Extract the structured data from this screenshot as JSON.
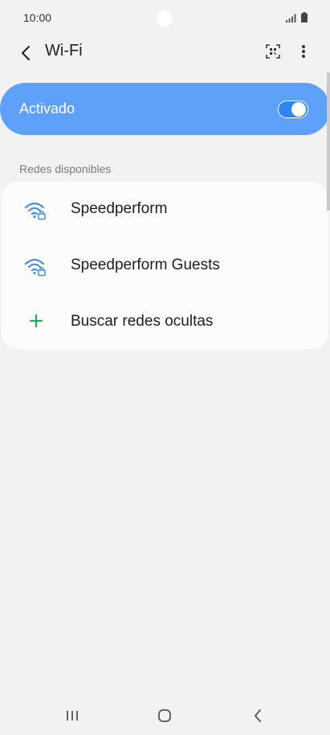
{
  "status_bar": {
    "time": "10:00",
    "signal_icon": "signal-icon",
    "battery_icon": "battery-icon"
  },
  "header": {
    "title": "Wi-Fi",
    "back_icon": "back-arrow-icon",
    "qr_icon": "qr-scan-icon",
    "more_icon": "more-vert-icon"
  },
  "wifi_toggle": {
    "label": "Activado",
    "state": "on",
    "accent_color": "#5ea1fa"
  },
  "available_networks": {
    "section_title": "Redes disponibles",
    "items": [
      {
        "label": "Speedperform",
        "icon": "wifi-secured-icon"
      },
      {
        "label": "Speedperform Guests",
        "icon": "wifi-secured-icon"
      },
      {
        "label": "Buscar redes ocultas",
        "icon": "plus-icon"
      }
    ]
  },
  "nav_bar": {
    "recents_icon": "recent-apps-icon",
    "home_icon": "home-icon",
    "back_icon": "nav-back-icon"
  }
}
